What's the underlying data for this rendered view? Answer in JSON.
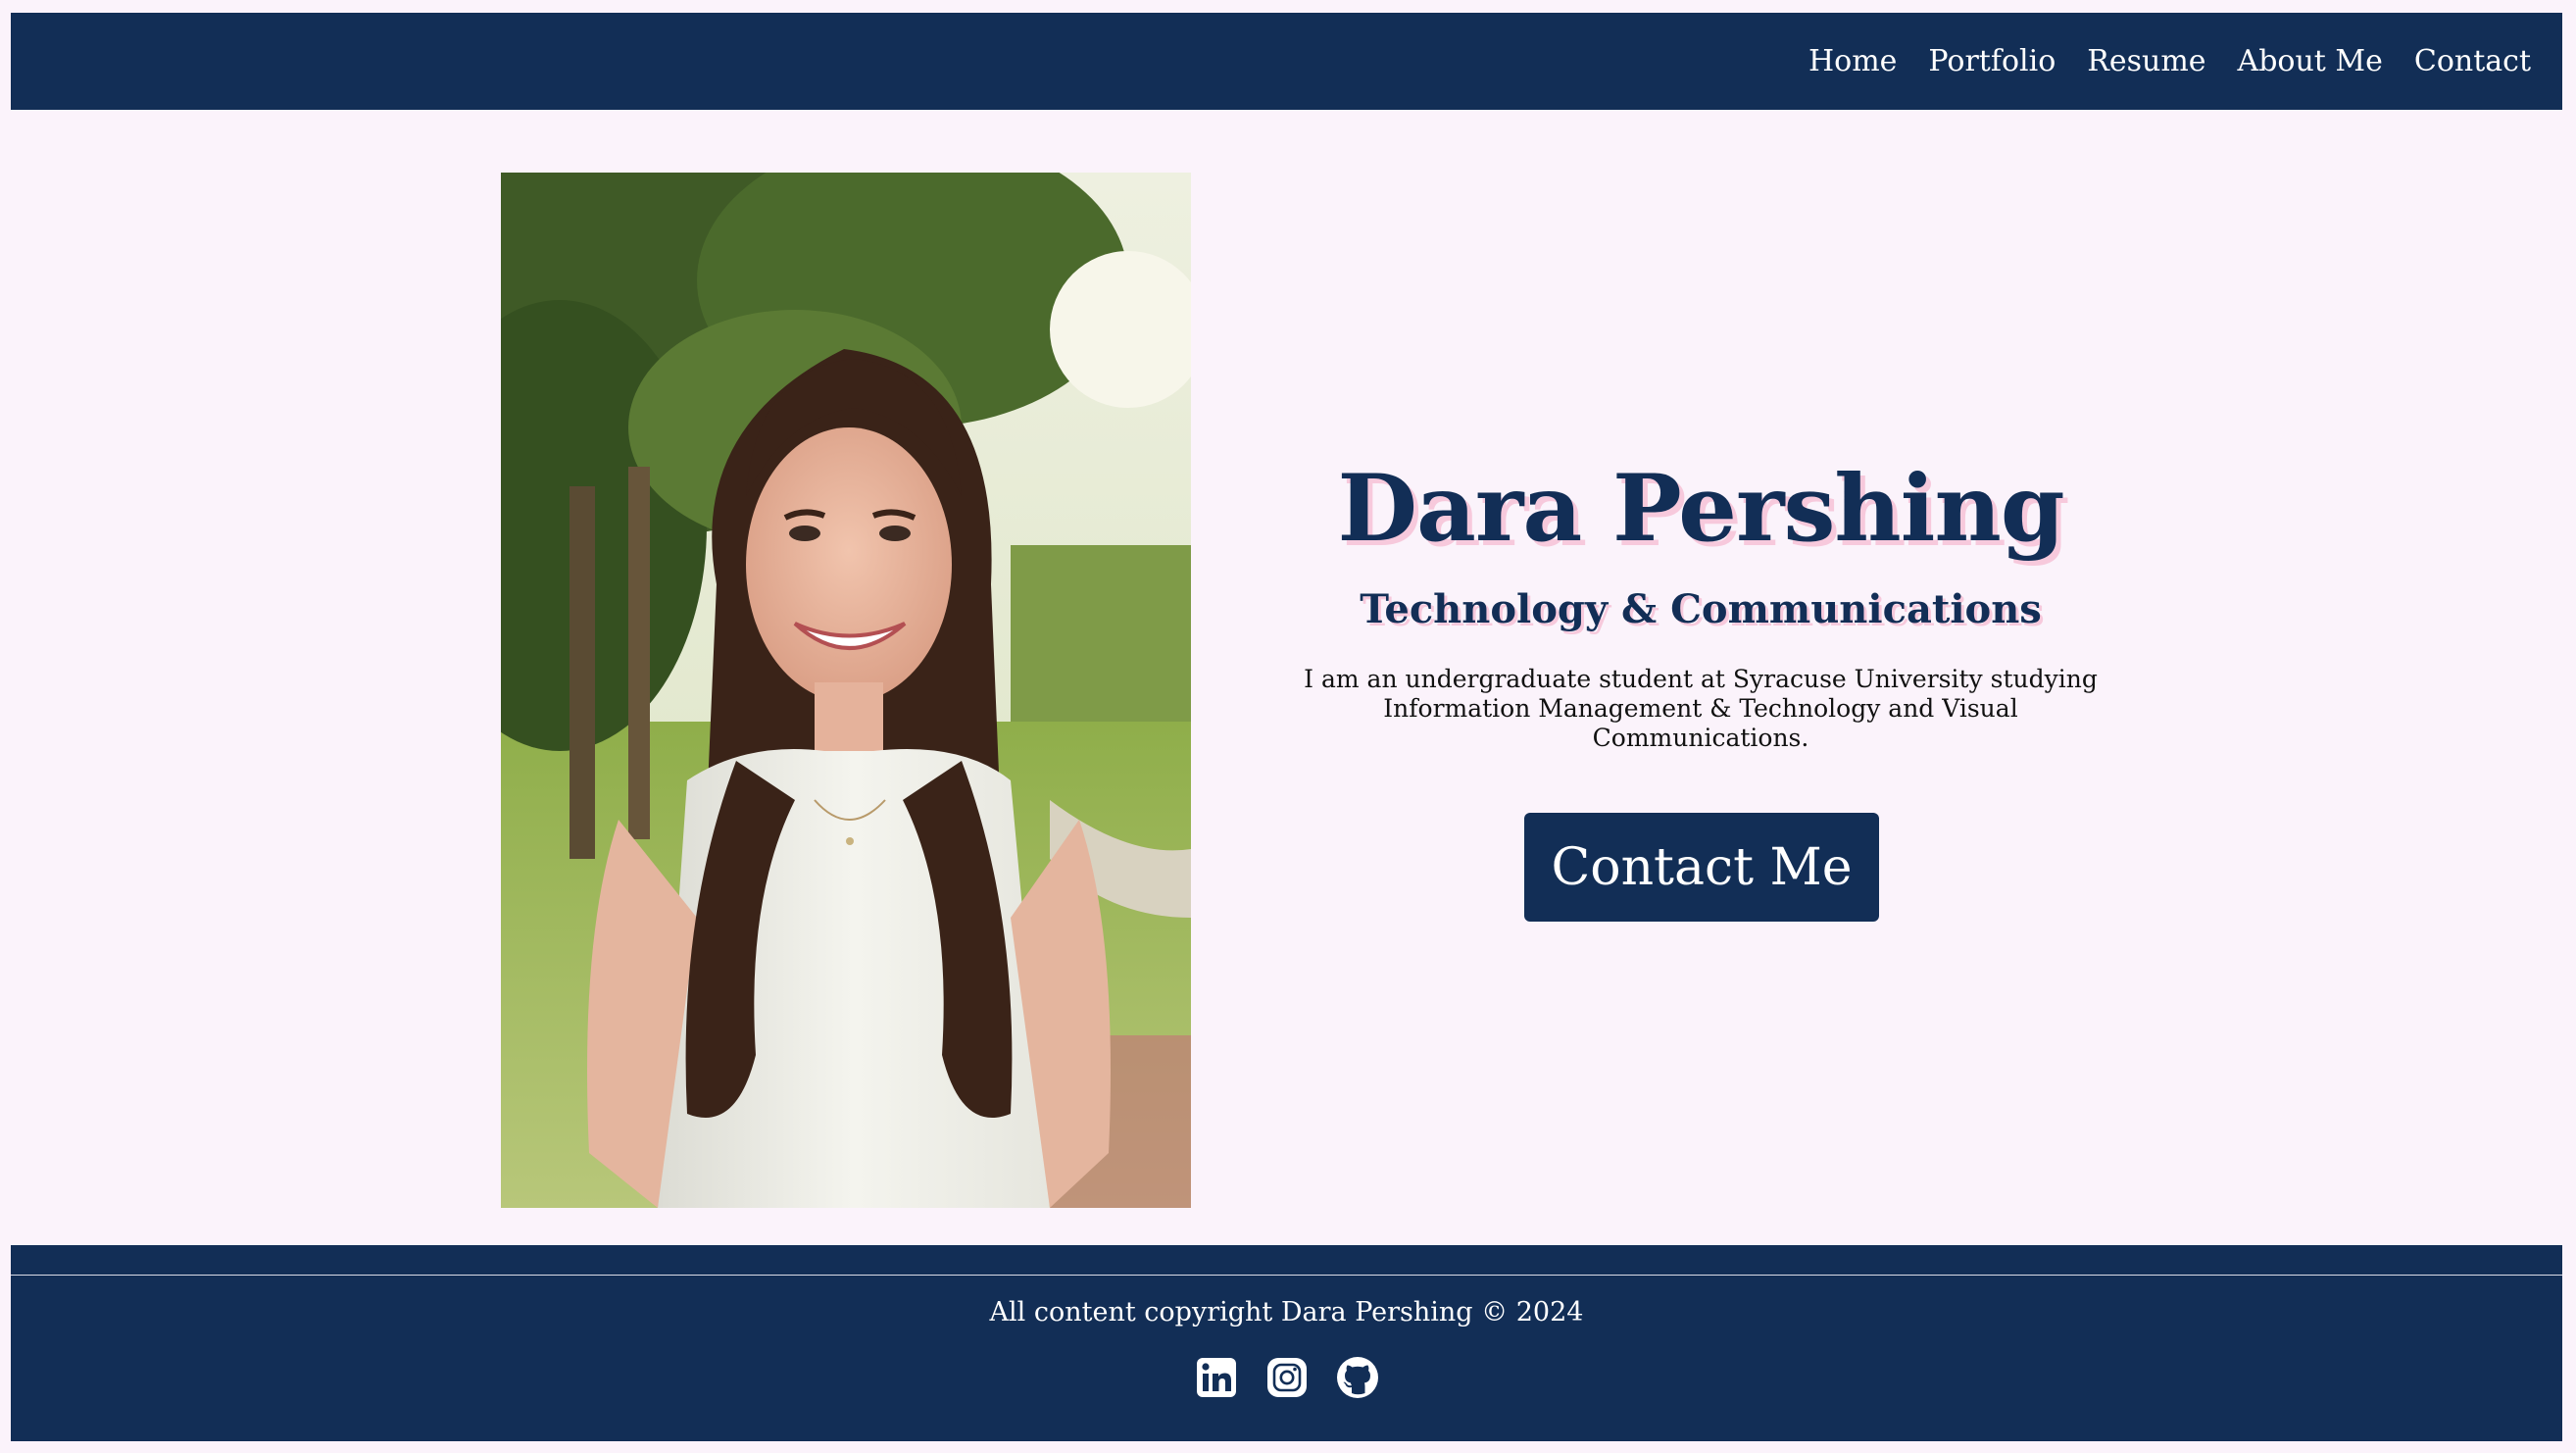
{
  "nav": {
    "items": [
      "Home",
      "Portfolio",
      "Resume",
      "About Me",
      "Contact"
    ]
  },
  "hero": {
    "name": "Dara Pershing",
    "subtitle": "Technology & Communications",
    "bio": "I am an undergraduate student at Syracuse University studying Information Management & Technology and Visual Communications.",
    "cta_label": "Contact Me"
  },
  "footer": {
    "copyright": "All content copyright Dara Pershing © 2024",
    "social": [
      {
        "icon": "linkedin-icon"
      },
      {
        "icon": "instagram-icon"
      },
      {
        "icon": "github-icon"
      }
    ]
  },
  "colors": {
    "navy": "#122e56",
    "background": "#fbf3fb",
    "text_shadow_pink": "#f7c9dc"
  }
}
